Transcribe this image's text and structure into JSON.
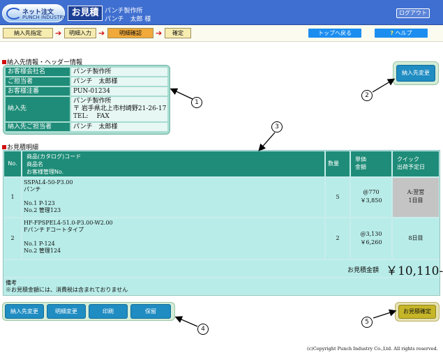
{
  "header": {
    "logo_text": "ネット注文",
    "logo_sub": "PUNCH INDUSTRY",
    "app_title": "お見積",
    "customer_name": "パンチ製作所",
    "customer_contact": "パンチ　太郎 様",
    "logout_label": "ログアウト"
  },
  "steps": [
    {
      "label": "納入先指定"
    },
    {
      "label": "明細入力"
    },
    {
      "label": "明細確認"
    },
    {
      "label": "確定"
    }
  ],
  "nav": {
    "top_label": "トップへ戻る",
    "help_label": "ヘルプ",
    "help_mark": "?"
  },
  "info": {
    "section_title": "納入先情報・ヘッダー情報",
    "rows": [
      {
        "label": "お客様会社名",
        "value": "パンチ製作所"
      },
      {
        "label": "ご担当者",
        "value": "パンチ　太郎様"
      },
      {
        "label": "お客様注番",
        "value": "PUN-01234"
      },
      {
        "label": "納入先",
        "value_lines": [
          "パンチ製作所",
          "〒 岩手県北上市村崎野21-26-17",
          "TEL:　 FAX"
        ]
      },
      {
        "label": "納入先ご担当者",
        "value": "パンチ　太郎様"
      }
    ],
    "change_button": "納入先変更"
  },
  "estimate": {
    "section_title": "お見積明細",
    "headers": {
      "no": "No.",
      "product_lines": [
        "商品(カタログ)コード",
        "商品名",
        "お客様管理No."
      ],
      "qty": "数量",
      "price_lines": [
        "単価",
        "金額"
      ],
      "ship_lines": [
        "クイック",
        "出荷予定日"
      ]
    },
    "rows": [
      {
        "no": "1",
        "code": "SSPAL4-50-P3.00",
        "name": "パンチ",
        "mgmt1": "No.1 P-123",
        "mgmt2": "No.2 管理123",
        "qty": "5",
        "unit_price": "@770",
        "amount": "￥3,850",
        "ship1": "A:翌営",
        "ship2": "1日目"
      },
      {
        "no": "2",
        "code": "HF-FPSPEL4-51.0-P3.00-W2.00",
        "name": "Fパンチ Fコートタイプ",
        "mgmt1": "No.1 P-124",
        "mgmt2": "No.2 管理124",
        "qty": "2",
        "unit_price": "@3,130",
        "amount": "￥6,260",
        "ship1": "8日目",
        "ship2": ""
      }
    ],
    "total_label": "お見積金額",
    "total_value": "￥10,110-",
    "remarks_label": "備考",
    "remarks_text": "※お見積金額には、消費税は含まれておりません"
  },
  "actions": {
    "change_dest": "納入先変更",
    "change_detail": "明細変更",
    "print": "印刷",
    "hold": "保留",
    "confirm": "お見積確定"
  },
  "callouts": [
    "1",
    "2",
    "3",
    "4",
    "5"
  ],
  "footer": {
    "copyright": "(c)Copyright Punch Industry Co.,Ltd. All rights reserved."
  }
}
